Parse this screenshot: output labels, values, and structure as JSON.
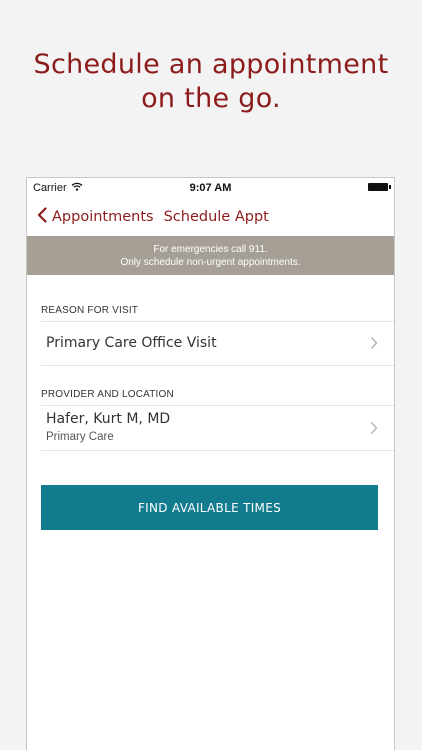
{
  "promo": {
    "line1": "Schedule an appointment",
    "line2": "on the go."
  },
  "status_bar": {
    "carrier": "Carrier",
    "time": "9:07 AM",
    "wifi_icon": "wifi-icon",
    "battery_icon": "battery-icon"
  },
  "nav": {
    "back_label": "Appointments",
    "title": "Schedule Appt",
    "back_icon": "chevron-left-icon"
  },
  "banner": {
    "line1": "For emergencies call 911.",
    "line2": "Only schedule non-urgent appointments."
  },
  "reason": {
    "section_label": "REASON FOR VISIT",
    "value": "Primary Care Office Visit"
  },
  "provider": {
    "section_label": "PROVIDER AND LOCATION",
    "name": "Hafer, Kurt M, MD",
    "location": "Primary Care"
  },
  "actions": {
    "find_times_label": "FIND AVAILABLE TIMES"
  },
  "colors": {
    "brand": "#8c1c1c",
    "banner_bg": "#a69f96",
    "button_bg": "#127b8d"
  }
}
